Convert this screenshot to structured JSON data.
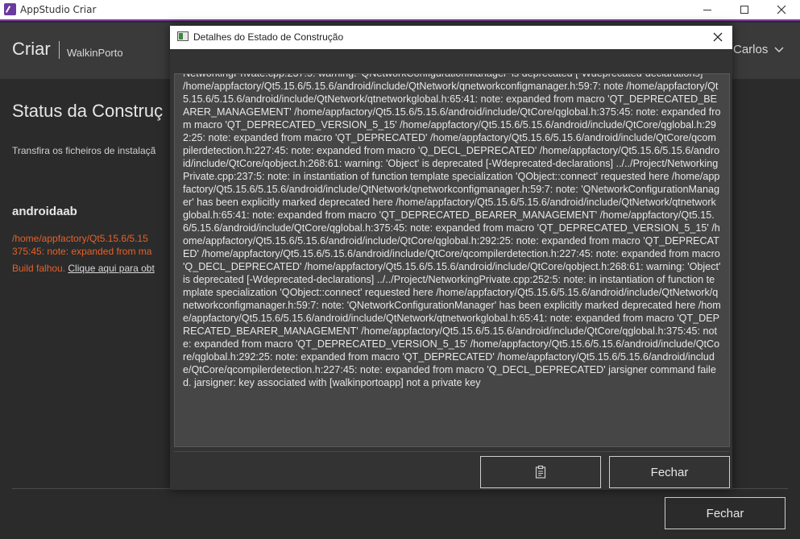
{
  "window": {
    "title": "AppStudio Criar",
    "icon": "appstudio-icon"
  },
  "header": {
    "brand": "Criar",
    "project": "WalkinPorto",
    "user": "Carlos"
  },
  "main": {
    "page_title": "Status da Construç",
    "description": "Transfira os ficheiros de instalaçã",
    "platform": "androidaab",
    "error_line1": "/home/appfactory/Qt5.15.6/5.15",
    "error_line2": "375:45: note: expanded from ma",
    "fail_text": "Build falhou.",
    "fail_link": "Clique aqui para obt",
    "close_label": "Fechar"
  },
  "dialog": {
    "title": "Detalhes do Estado de Construção",
    "log": "NetworkingPrivate.cpp:237:5: warning: 'QNetworkConfigurationManager' is deprecated [-Wdeprecated-declarations]\n/home/appfactory/Qt5.15.6/5.15.6/android/include/QtNetwork/qnetworkconfigmanager.h:59:7: note /home/appfactory/Qt5.15.6/5.15.6/android/include/QtNetwork/qtnetworkglobal.h:65:41: note: expanded from macro 'QT_DEPRECATED_BEARER_MANAGEMENT' /home/appfactory/Qt5.15.6/5.15.6/android/include/QtCore/qglobal.h:375:45: note: expanded from macro 'QT_DEPRECATED_VERSION_5_15' /home/appfactory/Qt5.15.6/5.15.6/android/include/QtCore/qglobal.h:292:25: note: expanded from macro 'QT_DEPRECATED' /home/appfactory/Qt5.15.6/5.15.6/android/include/QtCore/qcompilerdetection.h:227:45: note: expanded from macro 'Q_DECL_DEPRECATED' /home/appfactory/Qt5.15.6/5.15.6/android/include/QtCore/qobject.h:268:61: warning: 'Object' is deprecated [-Wdeprecated-declarations] ../../Project/NetworkingPrivate.cpp:237:5: note: in instantiation of function template specialization 'QObject::connect' requested here /home/appfactory/Qt5.15.6/5.15.6/android/include/QtNetwork/qnetworkconfigmanager.h:59:7: note: 'QNetworkConfigurationManager' has been explicitly marked deprecated here /home/appfactory/Qt5.15.6/5.15.6/android/include/QtNetwork/qtnetworkglobal.h:65:41: note: expanded from macro 'QT_DEPRECATED_BEARER_MANAGEMENT' /home/appfactory/Qt5.15.6/5.15.6/android/include/QtCore/qglobal.h:375:45: note: expanded from macro 'QT_DEPRECATED_VERSION_5_15' /home/appfactory/Qt5.15.6/5.15.6/android/include/QtCore/qglobal.h:292:25: note: expanded from macro 'QT_DEPRECATED' /home/appfactory/Qt5.15.6/5.15.6/android/include/QtCore/qcompilerdetection.h:227:45: note: expanded from macro 'Q_DECL_DEPRECATED' /home/appfactory/Qt5.15.6/5.15.6/android/include/QtCore/qobject.h:268:61: warning: 'Object' is deprecated [-Wdeprecated-declarations] ../../Project/NetworkingPrivate.cpp:252:5: note: in instantiation of function template specialization 'QObject::connect' requested here /home/appfactory/Qt5.15.6/5.15.6/android/include/QtNetwork/qnetworkconfigmanager.h:59:7: note: 'QNetworkConfigurationManager' has been explicitly marked deprecated here /home/appfactory/Qt5.15.6/5.15.6/android/include/QtNetwork/qtnetworkglobal.h:65:41: note: expanded from macro 'QT_DEPRECATED_BEARER_MANAGEMENT' /home/appfactory/Qt5.15.6/5.15.6/android/include/QtCore/qglobal.h:375:45: note: expanded from macro 'QT_DEPRECATED_VERSION_5_15' /home/appfactory/Qt5.15.6/5.15.6/android/include/QtCore/qglobal.h:292:25: note: expanded from macro 'QT_DEPRECATED' /home/appfactory/Qt5.15.6/5.15.6/android/include/QtCore/qcompilerdetection.h:227:45: note: expanded from macro 'Q_DECL_DEPRECATED' jarsigner command failed. jarsigner: key associated with [walkinportoapp] not a private key",
    "copy_icon": "clipboard-icon",
    "close_label": "Fechar"
  },
  "colors": {
    "accent": "#7a3f9e",
    "error": "#e4612a",
    "background": "#2b2b2b",
    "header_bg": "#3a3a3a",
    "log_bg": "#464646"
  }
}
